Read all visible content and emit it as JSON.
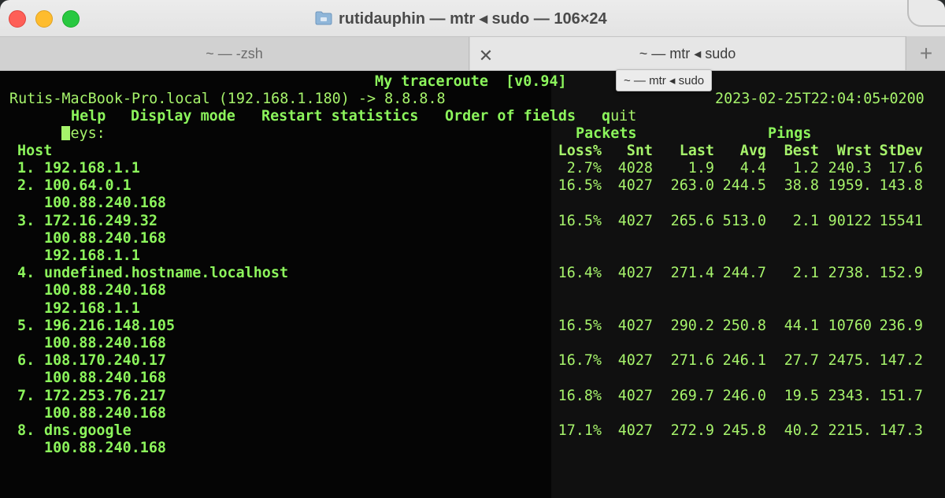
{
  "window": {
    "title": "rutidauphin — mtr ◂ sudo — 106×24",
    "folder_icon": "folder-icon"
  },
  "tabs": [
    {
      "label": "~ — -zsh"
    },
    {
      "label": "~ — mtr ◂ sudo"
    }
  ],
  "tab_close_label": "✕",
  "tab_add_label": "+",
  "tooltip": "~ — mtr ◂ sudo",
  "mtr": {
    "title": "My traceroute  [v0.94]",
    "source_line": "Rutis-MacBook-Pro.local (192.168.1.180) -> 8.8.8.8",
    "timestamp": "2023-02-25T22:04:05+0200",
    "keys_label": "eys:",
    "keys": [
      "Help",
      "Display mode",
      "Restart statistics",
      "Order of fields",
      "uit"
    ],
    "group_headers": {
      "packets": "Packets",
      "pings": "Pings"
    },
    "columns": {
      "host": "Host",
      "loss": "Loss%",
      "snt": "Snt",
      "last": "Last",
      "avg": "Avg",
      "best": "Best",
      "wrst": "Wrst",
      "stdev": "StDev"
    },
    "rows": [
      {
        "num": "1.",
        "host": "192.168.1.1",
        "loss": "2.7%",
        "snt": "4028",
        "last": "1.9",
        "avg": "4.4",
        "best": "1.2",
        "wrst": "240.3",
        "stdev": "17.6",
        "extra": []
      },
      {
        "num": "2.",
        "host": "100.64.0.1",
        "loss": "16.5%",
        "snt": "4027",
        "last": "263.0",
        "avg": "244.5",
        "best": "38.8",
        "wrst": "1959.",
        "stdev": "143.8",
        "extra": [
          "100.88.240.168"
        ]
      },
      {
        "num": "3.",
        "host": "172.16.249.32",
        "loss": "16.5%",
        "snt": "4027",
        "last": "265.6",
        "avg": "513.0",
        "best": "2.1",
        "wrst": "90122",
        "stdev": "15541",
        "extra": [
          "100.88.240.168",
          "192.168.1.1"
        ]
      },
      {
        "num": "4.",
        "host": "undefined.hostname.localhost",
        "loss": "16.4%",
        "snt": "4027",
        "last": "271.4",
        "avg": "244.7",
        "best": "2.1",
        "wrst": "2738.",
        "stdev": "152.9",
        "extra": [
          "100.88.240.168",
          "192.168.1.1"
        ]
      },
      {
        "num": "5.",
        "host": "196.216.148.105",
        "loss": "16.5%",
        "snt": "4027",
        "last": "290.2",
        "avg": "250.8",
        "best": "44.1",
        "wrst": "10760",
        "stdev": "236.9",
        "extra": [
          "100.88.240.168"
        ]
      },
      {
        "num": "6.",
        "host": "108.170.240.17",
        "loss": "16.7%",
        "snt": "4027",
        "last": "271.6",
        "avg": "246.1",
        "best": "27.7",
        "wrst": "2475.",
        "stdev": "147.2",
        "extra": [
          "100.88.240.168"
        ]
      },
      {
        "num": "7.",
        "host": "172.253.76.217",
        "loss": "16.8%",
        "snt": "4027",
        "last": "269.7",
        "avg": "246.0",
        "best": "19.5",
        "wrst": "2343.",
        "stdev": "151.7",
        "extra": [
          "100.88.240.168"
        ]
      },
      {
        "num": "8.",
        "host": "dns.google",
        "loss": "17.1%",
        "snt": "4027",
        "last": "272.9",
        "avg": "245.8",
        "best": "40.2",
        "wrst": "2215.",
        "stdev": "147.3",
        "extra": [
          "100.88.240.168"
        ]
      }
    ]
  },
  "colors": {
    "terminal_bg": "#050505",
    "terminal_fg": "#a6f36b",
    "close": "#fe5f57",
    "minimize": "#febc2e",
    "maximize": "#28c840"
  }
}
